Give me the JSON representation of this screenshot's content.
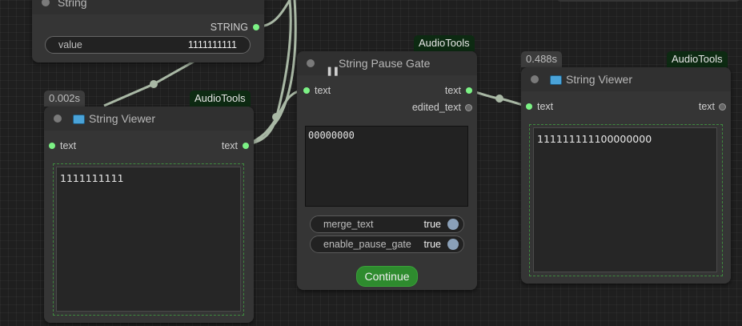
{
  "nodes": {
    "string_node": {
      "title": "String",
      "output_label": "STRING",
      "widget_label": "value",
      "widget_value": "1111111111"
    },
    "viewer_left": {
      "time_badge": "0.002s",
      "group_badge": "AudioTools",
      "title": "String Viewer",
      "input_label": "text",
      "output_label": "text",
      "content": "1111111111"
    },
    "pause_gate": {
      "group_badge": "AudioTools",
      "title": "String Pause Gate",
      "input_label": "text",
      "output_text_label": "text",
      "output_edited_label": "edited_text",
      "textarea_value": "00000000",
      "merge_text_label": "merge_text",
      "merge_text_value": "true",
      "enable_pause_label": "enable_pause_gate",
      "enable_pause_value": "true",
      "continue_label": "Continue"
    },
    "viewer_right": {
      "time_badge": "0.488s",
      "group_badge": "AudioTools",
      "title": "String Viewer",
      "input_label": "text",
      "output_label": "text",
      "content": "111111111100000000"
    }
  },
  "colors": {
    "link": "#a9b8a5",
    "slot_connected": "#7cf285",
    "group_badge_bg": "#0d2a12",
    "continue_button": "#2e8b2e"
  }
}
